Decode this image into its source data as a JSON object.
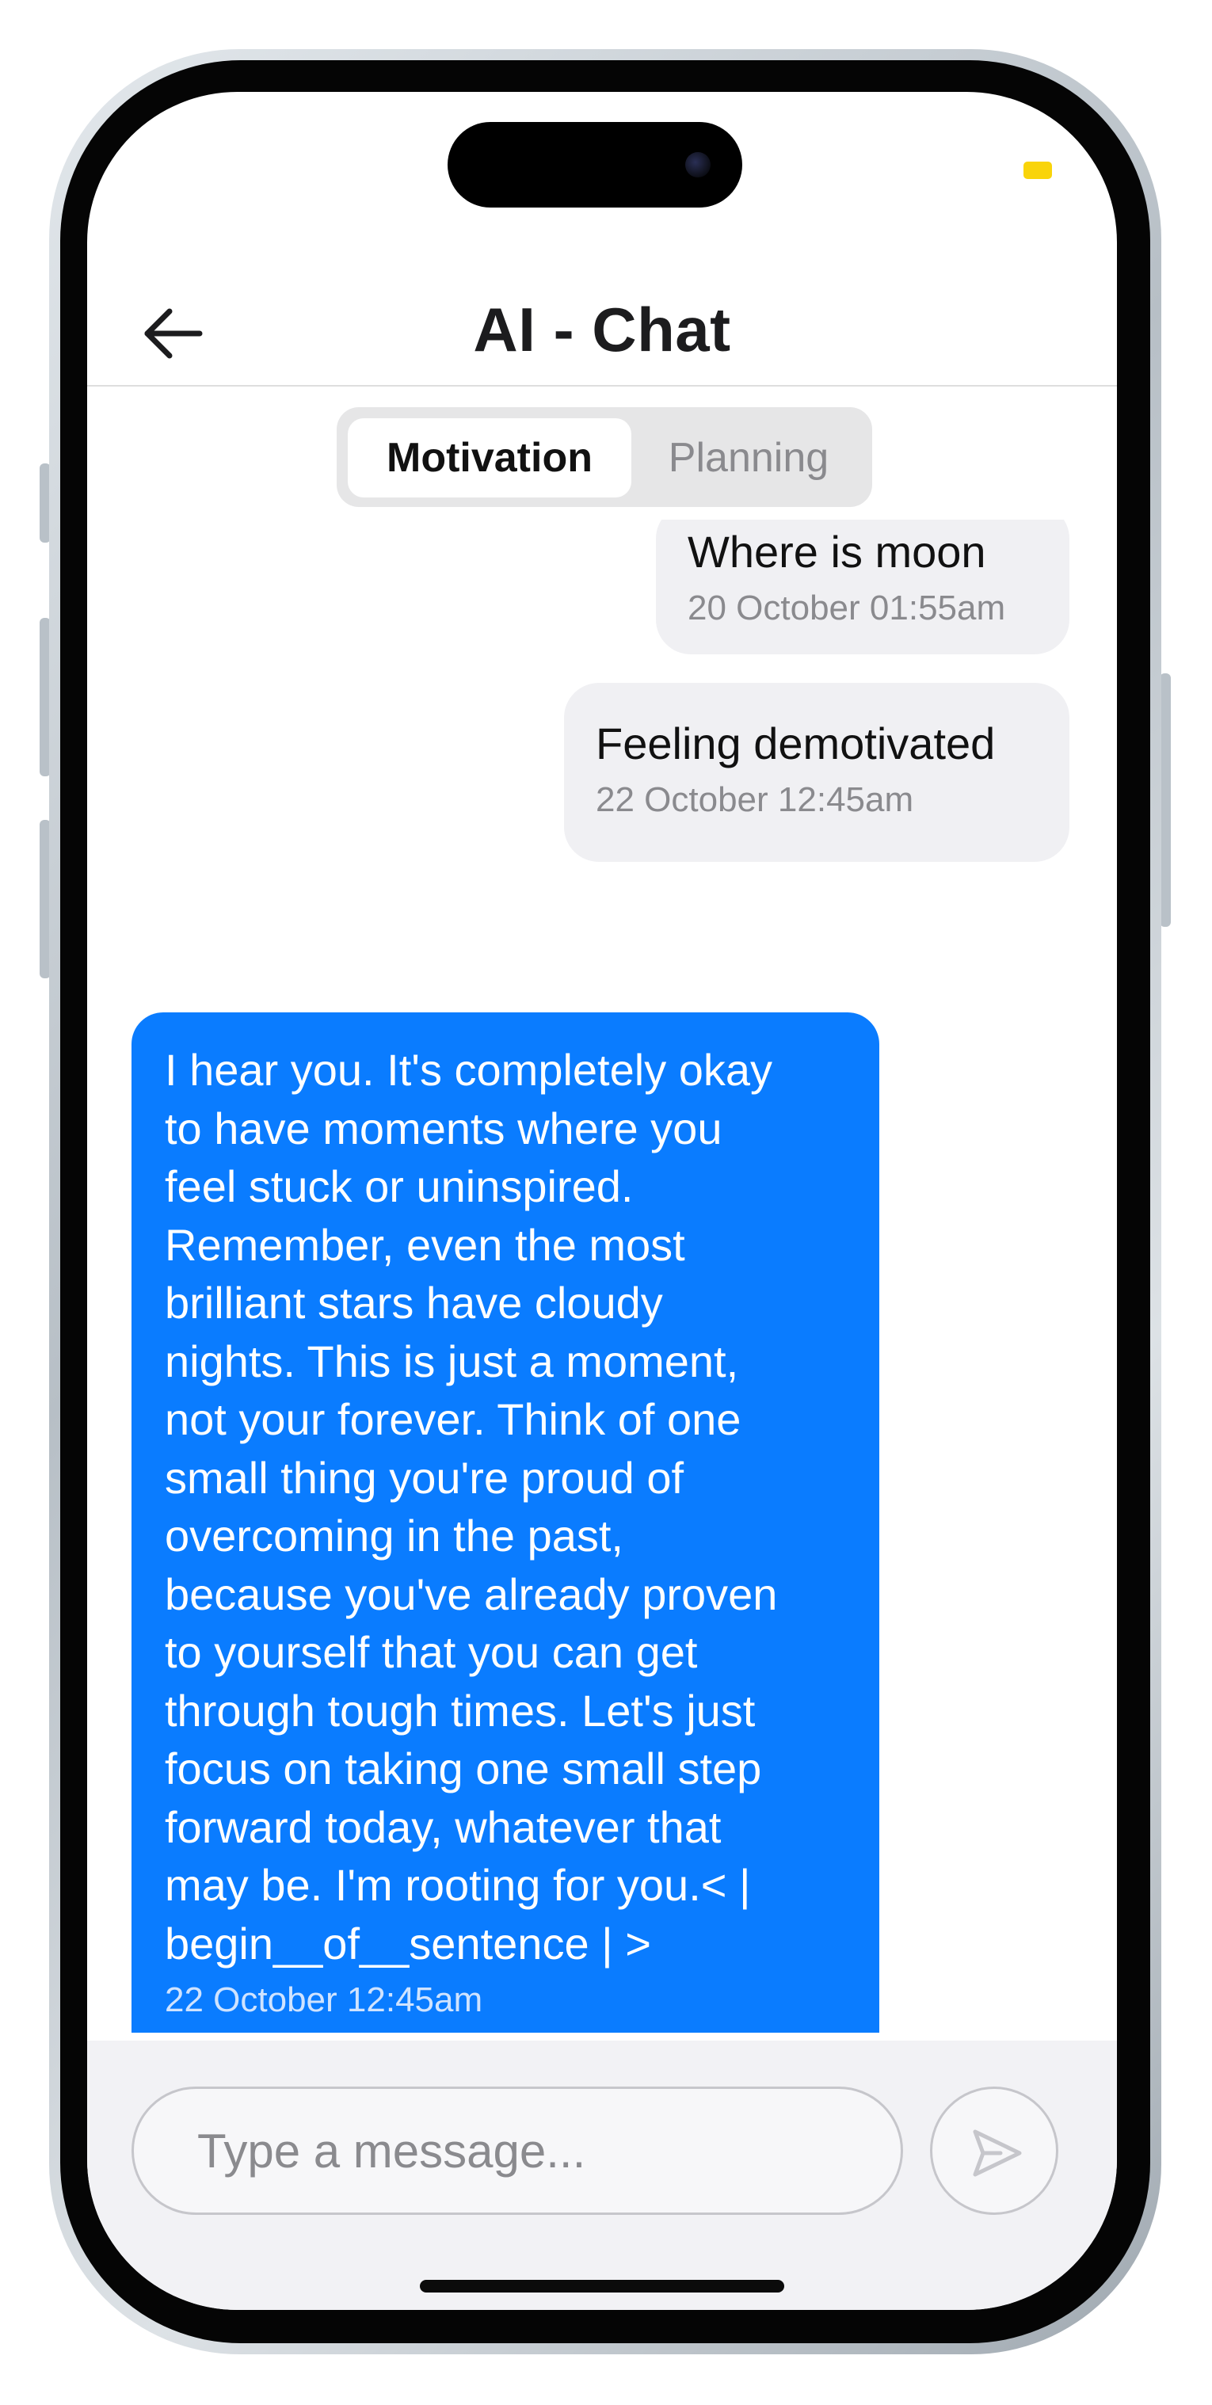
{
  "header": {
    "title": "AI - Chat",
    "back_icon": "arrow-left-icon"
  },
  "tabs": [
    {
      "label": "Motivation",
      "selected": true
    },
    {
      "label": "Planning",
      "selected": false
    }
  ],
  "messages": [
    {
      "sender": "user",
      "text": "Where is moon",
      "timestamp": "20 October 01:55am"
    },
    {
      "sender": "user",
      "text": "Feeling demotivated",
      "timestamp": "22 October 12:45am"
    },
    {
      "sender": "ai",
      "text": "I hear you. It's completely okay\nto have moments where you\nfeel stuck or uninspired.\nRemember, even the most\nbrilliant stars have cloudy\nnights. This is just a moment,\nnot your forever. Think of one\nsmall thing you're proud of\novercoming in the past,\nbecause you've already proven\nto yourself that you can get\nthrough tough times. Let's just\nfocus on taking one small step\nforward today, whatever that\nmay be. I'm rooting for you.< |\nbegin__of__sentence | >",
      "timestamp": "22 October 12:45am"
    }
  ],
  "composer": {
    "placeholder": "Type a message...",
    "value": "",
    "send_icon": "send-icon"
  },
  "colors": {
    "accent": "#0a7cff",
    "user_bubble": "#f0f0f3",
    "privacy_indicator": "#f9d40a"
  }
}
